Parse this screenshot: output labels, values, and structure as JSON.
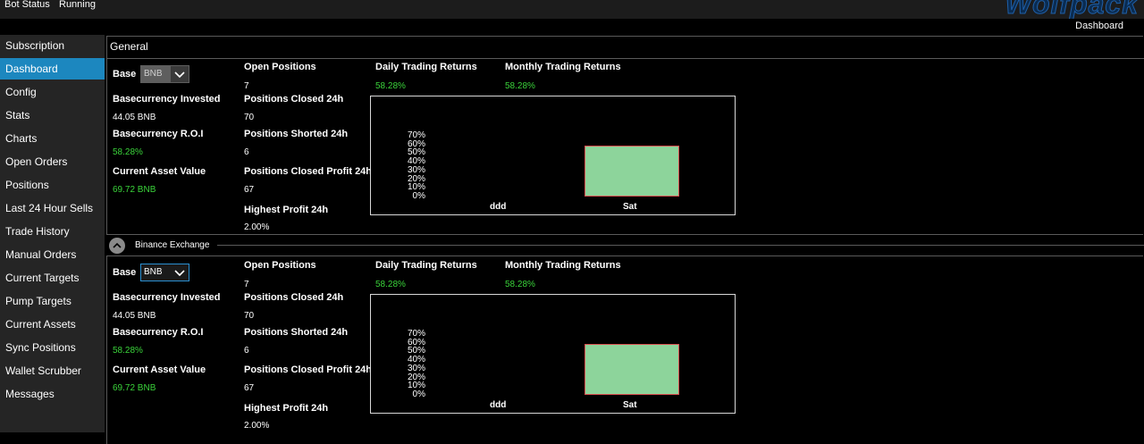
{
  "topbar": {
    "bot_status_label": "Bot Status",
    "bot_status_value": "Running",
    "logo_text": "Wolfpack",
    "page_tab": "Dashboard"
  },
  "sidebar": {
    "items": [
      {
        "label": "Subscription"
      },
      {
        "label": "Dashboard"
      },
      {
        "label": "Config"
      },
      {
        "label": "Stats"
      },
      {
        "label": "Charts"
      },
      {
        "label": "Open Orders"
      },
      {
        "label": "Positions"
      },
      {
        "label": "Last 24 Hour Sells"
      },
      {
        "label": "Trade History"
      },
      {
        "label": "Manual Orders"
      },
      {
        "label": "Current Targets"
      },
      {
        "label": "Pump Targets"
      },
      {
        "label": "Current Assets"
      },
      {
        "label": "Sync Positions"
      },
      {
        "label": "Wallet Scrubber"
      },
      {
        "label": "Messages"
      }
    ],
    "active_index": 1
  },
  "general": {
    "title": "General",
    "base_label": "Base",
    "base_value": "BNB",
    "invested_label": "Basecurrency Invested",
    "invested_value": "44.05 BNB",
    "roi_label": "Basecurrency R.O.I",
    "roi_value": "58.28%",
    "asset_label": "Current Asset Value",
    "asset_value": "69.72 BNB",
    "open_label": "Open Positions",
    "open_value": "7",
    "closed_label": "Positions Closed 24h",
    "closed_value": "70",
    "shorted_label": "Positions Shorted 24h",
    "shorted_value": "6",
    "profit_label": "Positions Closed Profit 24h",
    "profit_value": "67",
    "highest_label": "Highest Profit 24h",
    "highest_value": "2.00%",
    "daily_label": "Daily Trading Returns",
    "daily_value": "58.28%",
    "monthly_label": "Monthly Trading Returns",
    "monthly_value": "58.28%"
  },
  "exchange": {
    "title": "Binance Exchange",
    "base_label": "Base",
    "base_value": "BNB",
    "invested_label": "Basecurrency Invested",
    "invested_value": "44.05 BNB",
    "roi_label": "Basecurrency R.O.I",
    "roi_value": "58.28%",
    "asset_label": "Current Asset Value",
    "asset_value": "69.72 BNB",
    "open_label": "Open Positions",
    "open_value": "7",
    "closed_label": "Positions Closed 24h",
    "closed_value": "70",
    "shorted_label": "Positions Shorted 24h",
    "shorted_value": "6",
    "profit_label": "Positions Closed Profit 24h",
    "profit_value": "67",
    "highest_label": "Highest Profit 24h",
    "highest_value": "2.00%",
    "daily_label": "Daily Trading Returns",
    "daily_value": "58.28%",
    "monthly_label": "Monthly Trading Returns",
    "monthly_value": "58.28%"
  },
  "chart_data": [
    {
      "type": "bar",
      "categories": [
        "ddd",
        "Sat"
      ],
      "values": [
        null,
        58.28
      ],
      "y_ticks": [
        "70%",
        "60%",
        "50%",
        "40%",
        "30%",
        "20%",
        "10%",
        "0%"
      ],
      "ylim": [
        0,
        70
      ]
    },
    {
      "type": "bar",
      "categories": [
        "ddd",
        "Sat"
      ],
      "values": [
        null,
        58.28
      ],
      "y_ticks": [
        "70%",
        "60%",
        "50%",
        "40%",
        "30%",
        "20%",
        "10%",
        "0%"
      ],
      "ylim": [
        0,
        70
      ]
    }
  ],
  "colors": {
    "accent": "#1c87bf",
    "positive": "#3ad33a",
    "bar_fill": "#8dd49b",
    "bar_border": "#d85050"
  }
}
